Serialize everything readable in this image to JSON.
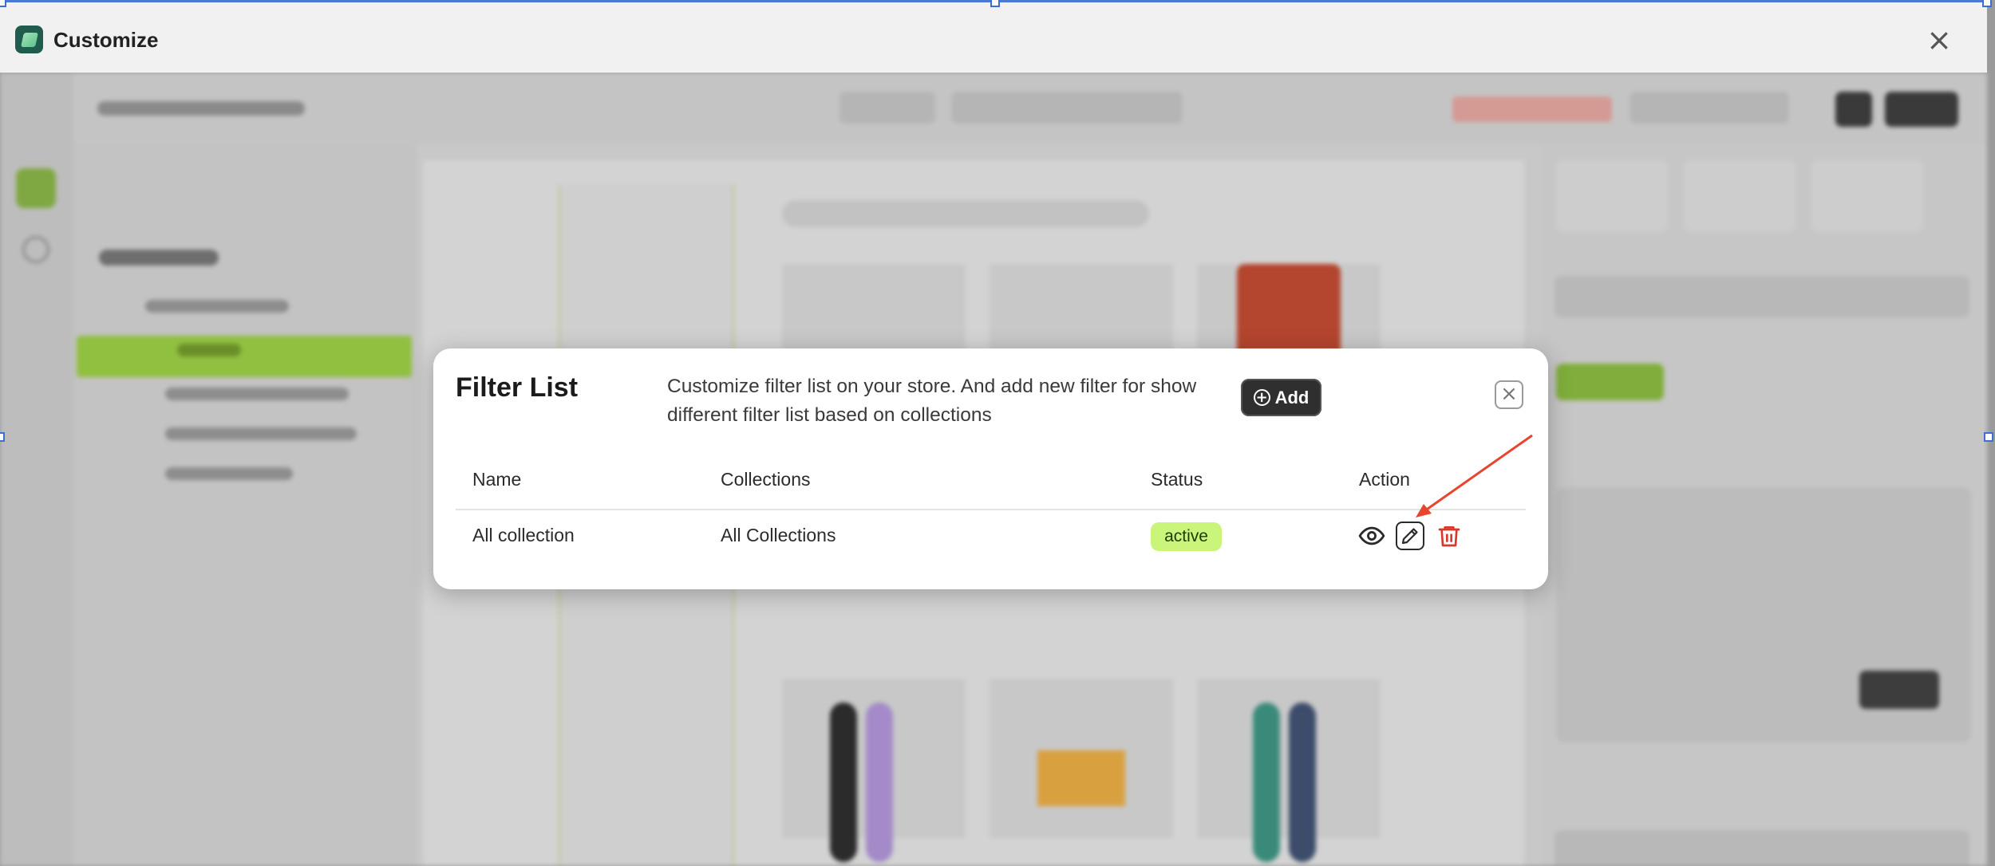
{
  "window": {
    "title": "Customize",
    "close_glyph": "×"
  },
  "modal": {
    "title": "Filter List",
    "description": "Customize filter list on your store. And add new filter for show different filter list based on collections",
    "add_label": "Add",
    "close_glyph": "×",
    "columns": [
      "Name",
      "Collections",
      "Status",
      "Action"
    ],
    "rows": [
      {
        "name": "All collection",
        "collections": "All Collections",
        "status": "active"
      }
    ]
  },
  "icons": {
    "app_logo": "app-logo-icon",
    "view": "eye-icon",
    "edit": "pencil-icon",
    "delete": "trash-icon",
    "add": "plus-circle-icon"
  },
  "colors": {
    "status_active_bg": "#c9f57a",
    "delete_red": "#d9382c",
    "annotation_arrow": "#e8442e",
    "add_button_bg": "#2f2f2f"
  }
}
